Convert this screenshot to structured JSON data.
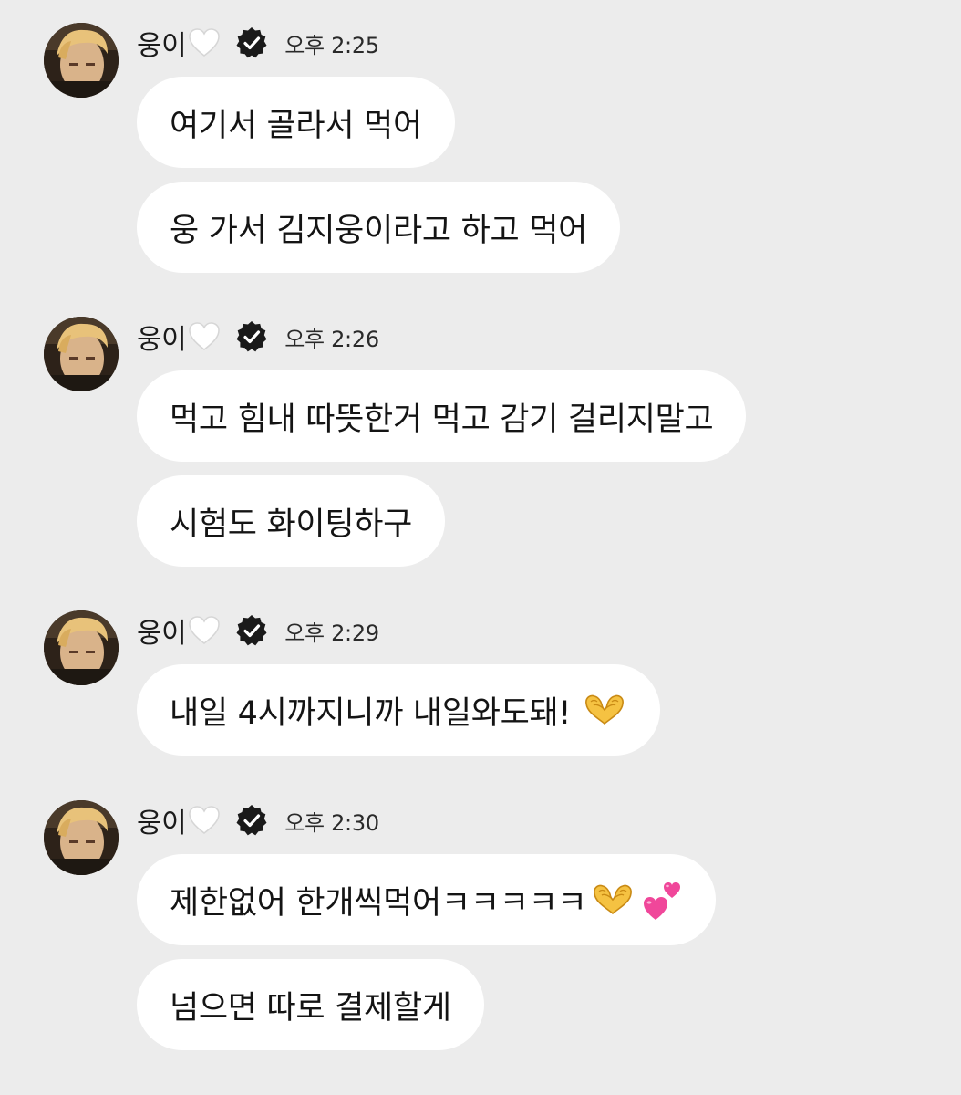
{
  "chat": {
    "groups": [
      {
        "sender": "웅이",
        "time": "오후 2:25",
        "messages": [
          {
            "text": "여기서 골라서 먹어"
          },
          {
            "text": "웅 가서 김지웅이라고 하고 먹어"
          }
        ]
      },
      {
        "sender": "웅이",
        "time": "오후 2:26",
        "messages": [
          {
            "text": "먹고 힘내 따뜻한거 먹고 감기 걸리지말고"
          },
          {
            "text": "시험도 화이팅하구"
          }
        ]
      },
      {
        "sender": "웅이",
        "time": "오후 2:29",
        "messages": [
          {
            "text": "내일 4시까지니까 내일와도돼!",
            "emojis": [
              "heart-hands"
            ]
          }
        ]
      },
      {
        "sender": "웅이",
        "time": "오후 2:30",
        "messages": [
          {
            "text": "제한없어 한개씩먹어ㅋㅋㅋㅋㅋ",
            "emojis": [
              "heart-hands",
              "two-hearts"
            ]
          },
          {
            "text": "넘으면 따로 결제할게"
          }
        ]
      }
    ],
    "icons": {
      "name_suffix": "white-heart-icon",
      "verified": "verified-badge-icon"
    }
  }
}
